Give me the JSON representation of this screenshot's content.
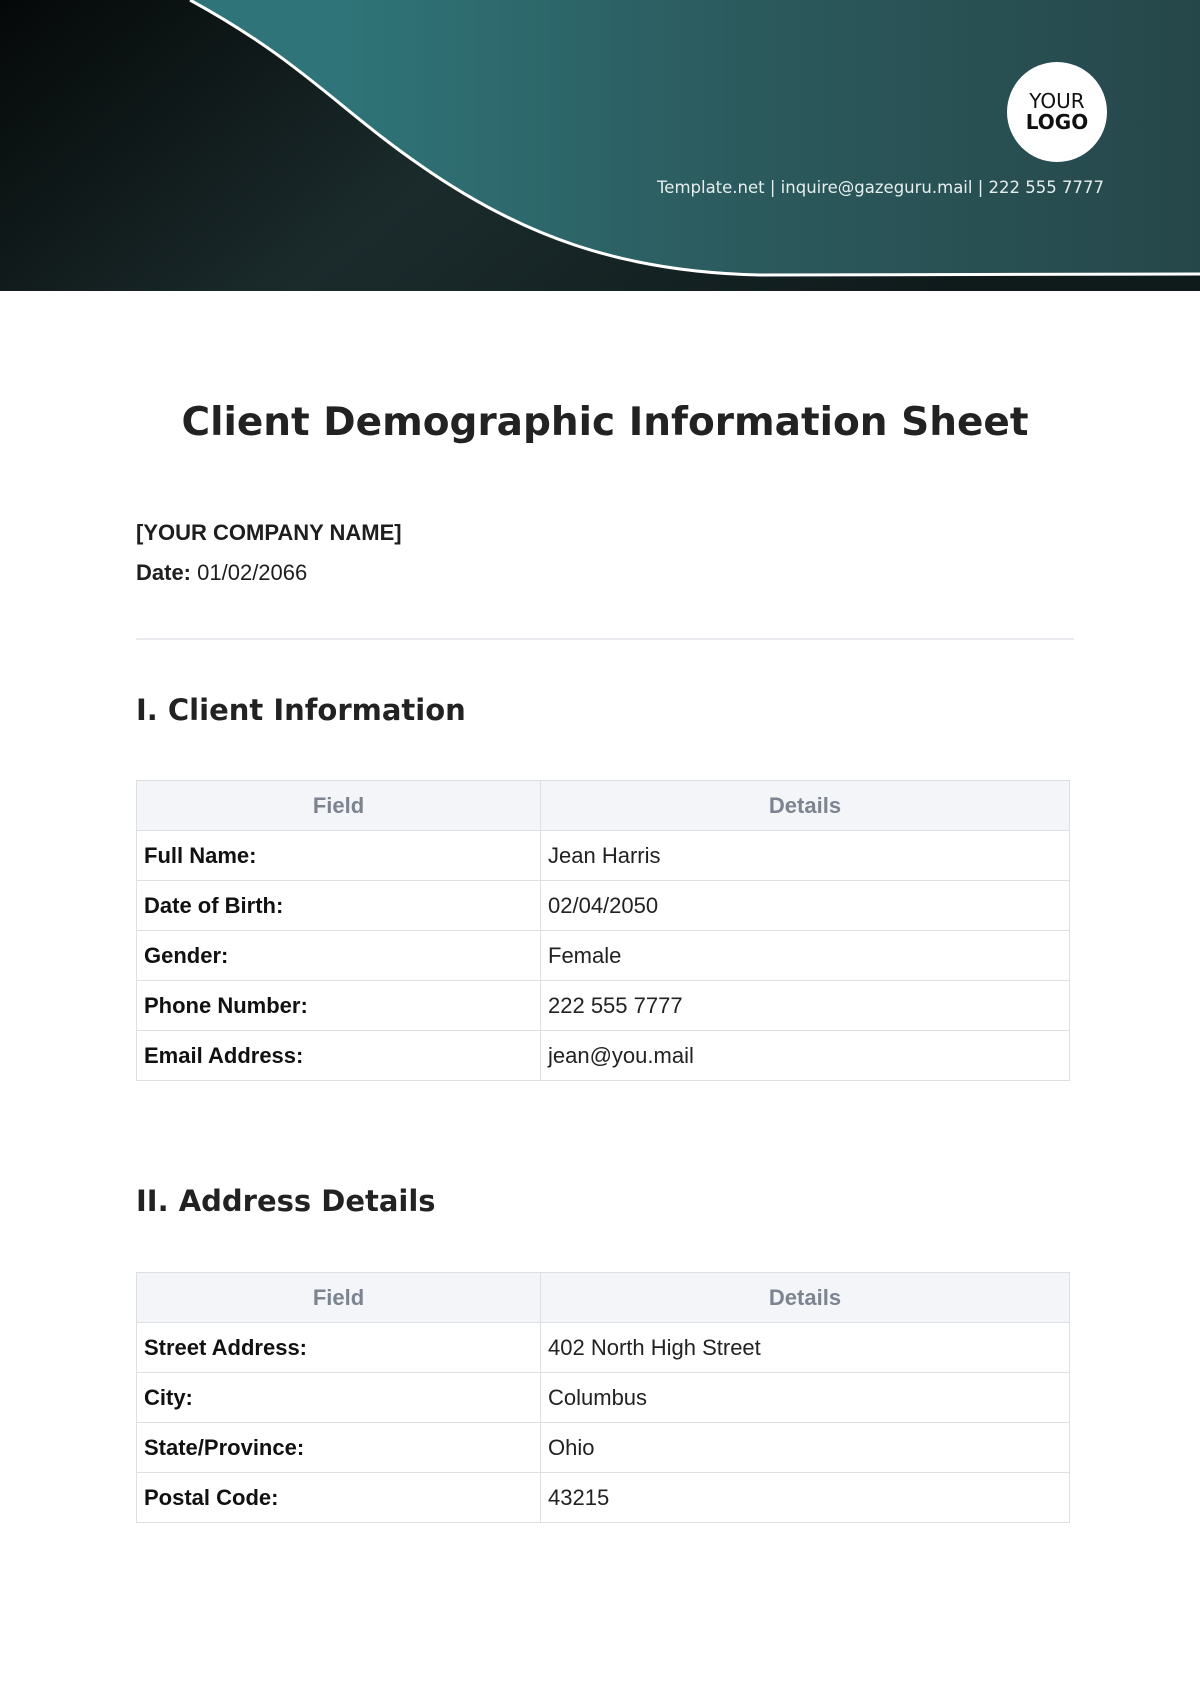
{
  "header": {
    "logo": {
      "line1": "YOUR",
      "line2": "LOGO"
    },
    "contact": "Template.net | inquire@gazeguru.mail | 222 555 7777",
    "colors": {
      "dark": "#0b0f0f",
      "teal": "#2f7478",
      "deep_teal": "#27474a"
    }
  },
  "title": "Client Demographic Information Sheet",
  "company_name": "[YOUR COMPANY NAME]",
  "date": {
    "label": "Date:",
    "value": "01/02/2066"
  },
  "sections": [
    {
      "heading": "I. Client Information",
      "columns": [
        "Field",
        "Details"
      ],
      "rows": [
        {
          "field": "Full Name:",
          "value": "Jean Harris"
        },
        {
          "field": "Date of Birth:",
          "value": "02/04/2050"
        },
        {
          "field": "Gender:",
          "value": "Female"
        },
        {
          "field": "Phone Number:",
          "value": "222 555 7777"
        },
        {
          "field": "Email Address:",
          "value": "jean@you.mail"
        }
      ]
    },
    {
      "heading": "II. Address Details",
      "columns": [
        "Field",
        "Details"
      ],
      "rows": [
        {
          "field": "Street Address:",
          "value": "402 North High Street"
        },
        {
          "field": "City:",
          "value": "Columbus"
        },
        {
          "field": "State/Province:",
          "value": "Ohio"
        },
        {
          "field": "Postal Code:",
          "value": "43215"
        }
      ]
    }
  ]
}
